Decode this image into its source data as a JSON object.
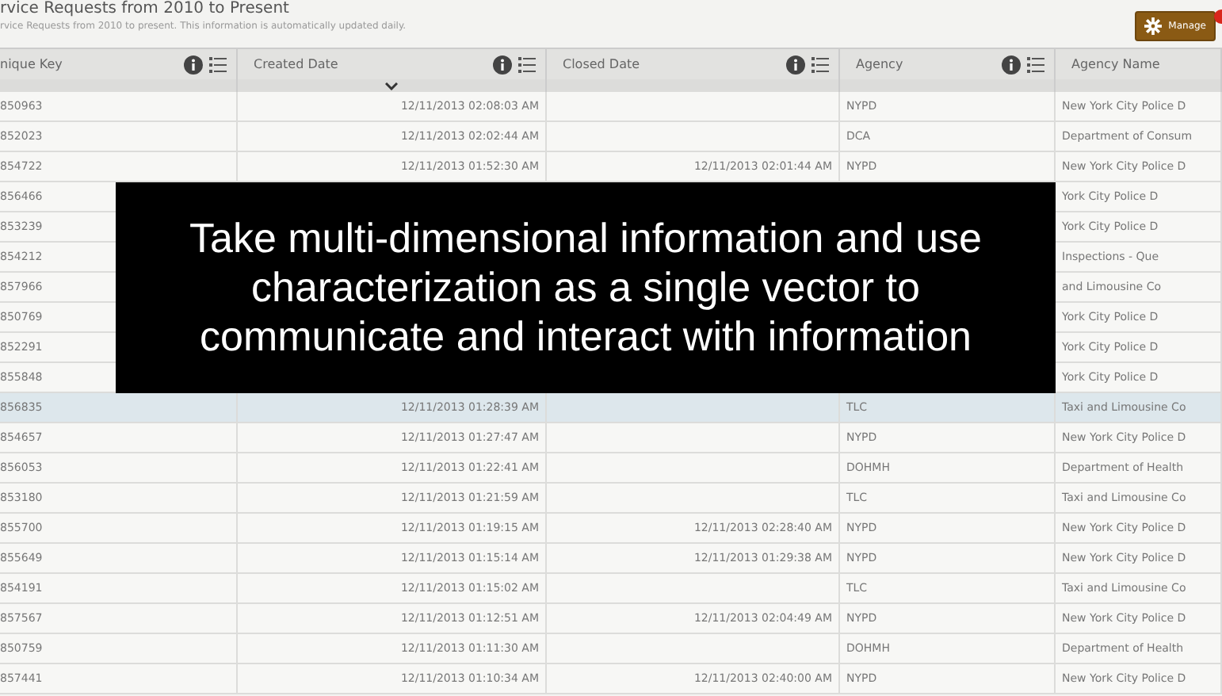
{
  "header": {
    "title": "rvice Requests from 2010 to Present",
    "subtitle": "rvice Requests from 2010 to present. This information is automatically updated daily.",
    "manage_button": {
      "label": "Manage"
    },
    "notification": true
  },
  "table": {
    "columns": [
      {
        "label": "nique Key",
        "sorted": false
      },
      {
        "label": "Created Date",
        "sorted": true
      },
      {
        "label": "Closed Date",
        "sorted": false
      },
      {
        "label": "Agency",
        "sorted": false
      },
      {
        "label": "Agency Name",
        "sorted": false
      }
    ],
    "rows": [
      {
        "selected": false,
        "cells": [
          "850963",
          "12/11/2013 02:08:03 AM",
          null,
          "NYPD",
          "New York City Police D"
        ]
      },
      {
        "selected": false,
        "cells": [
          "852023",
          "12/11/2013 02:02:44 AM",
          null,
          "DCA",
          "Department of Consum"
        ]
      },
      {
        "selected": false,
        "cells": [
          "854722",
          "12/11/2013 01:52:30 AM",
          "12/11/2013 02:01:44 AM",
          "NYPD",
          "New York City Police D"
        ]
      },
      {
        "selected": false,
        "cells": [
          "856466",
          null,
          null,
          null,
          "York City Police D"
        ]
      },
      {
        "selected": false,
        "cells": [
          "853239",
          null,
          null,
          null,
          "York City Police D"
        ]
      },
      {
        "selected": false,
        "cells": [
          "854212",
          null,
          null,
          null,
          "Inspections - Que"
        ]
      },
      {
        "selected": false,
        "cells": [
          "857966",
          null,
          null,
          null,
          "and Limousine Co"
        ]
      },
      {
        "selected": false,
        "cells": [
          "850769",
          null,
          null,
          null,
          "York City Police D"
        ]
      },
      {
        "selected": false,
        "cells": [
          "852291",
          null,
          null,
          null,
          "York City Police D"
        ]
      },
      {
        "selected": false,
        "cells": [
          "855848",
          null,
          null,
          null,
          "York City Police D"
        ]
      },
      {
        "selected": true,
        "cells": [
          "856835",
          "12/11/2013 01:28:39 AM",
          null,
          "TLC",
          "Taxi and Limousine Co"
        ]
      },
      {
        "selected": false,
        "cells": [
          "854657",
          "12/11/2013 01:27:47 AM",
          null,
          "NYPD",
          "New York City Police D"
        ]
      },
      {
        "selected": false,
        "cells": [
          "856053",
          "12/11/2013 01:22:41 AM",
          null,
          "DOHMH",
          "Department of Health"
        ]
      },
      {
        "selected": false,
        "cells": [
          "853180",
          "12/11/2013 01:21:59 AM",
          null,
          "TLC",
          "Taxi and Limousine Co"
        ]
      },
      {
        "selected": false,
        "cells": [
          "855700",
          "12/11/2013 01:19:15 AM",
          "12/11/2013 02:28:40 AM",
          "NYPD",
          "New York City Police D"
        ]
      },
      {
        "selected": false,
        "cells": [
          "855649",
          "12/11/2013 01:15:14 AM",
          "12/11/2013 01:29:38 AM",
          "NYPD",
          "New York City Police D"
        ]
      },
      {
        "selected": false,
        "cells": [
          "854191",
          "12/11/2013 01:15:02 AM",
          null,
          "TLC",
          "Taxi and Limousine Co"
        ]
      },
      {
        "selected": false,
        "cells": [
          "857567",
          "12/11/2013 01:12:51 AM",
          "12/11/2013 02:04:49 AM",
          "NYPD",
          "New York City Police D"
        ]
      },
      {
        "selected": false,
        "cells": [
          "850759",
          "12/11/2013 01:11:30 AM",
          null,
          "DOHMH",
          "Department of Health"
        ]
      },
      {
        "selected": false,
        "cells": [
          "857441",
          "12/11/2013 01:10:34 AM",
          "12/11/2013 02:40:00 AM",
          "NYPD",
          "New York City Police D"
        ]
      }
    ]
  },
  "caption": {
    "lines": [
      "Take multi-dimensional information and use",
      "characterization as a single vector to",
      "communicate and interact with information"
    ]
  }
}
